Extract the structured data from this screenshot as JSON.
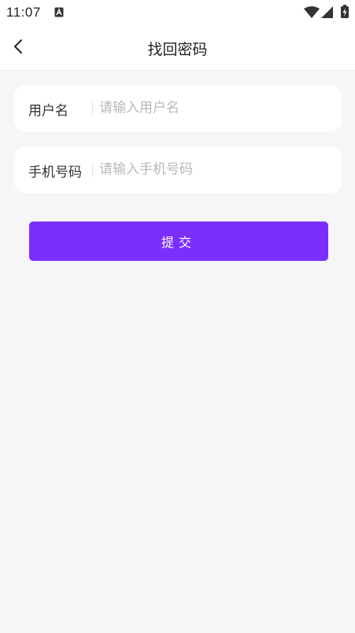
{
  "status_bar": {
    "time": "11:07",
    "notification_icon": "a-icon",
    "wifi_icon": "wifi-icon",
    "signal_icon": "signal-icon",
    "battery_icon": "battery-charging-icon"
  },
  "header": {
    "back_icon": "chevron-left-icon",
    "title": "找回密码"
  },
  "form": {
    "username": {
      "label": "用户名",
      "placeholder": "请输入用户名",
      "value": ""
    },
    "phone": {
      "label": "手机号码",
      "placeholder": "请输入手机号码",
      "value": ""
    },
    "submit_label": "提交"
  },
  "colors": {
    "accent": "#7b2fff",
    "background": "#f6f6f9",
    "card": "#ffffff",
    "placeholder": "#b8b8b8"
  }
}
